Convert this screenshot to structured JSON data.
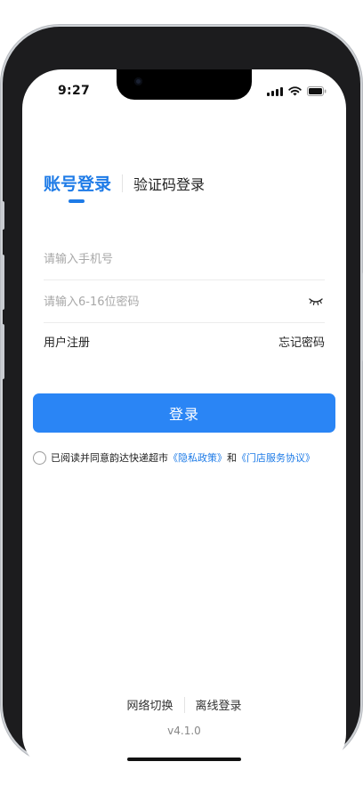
{
  "status_bar": {
    "time": "9:27"
  },
  "tabs": {
    "account_login": "账号登录",
    "code_login": "验证码登录"
  },
  "form": {
    "phone_placeholder": "请输入手机号",
    "phone_value": "",
    "password_placeholder": "请输入6-16位密码",
    "password_value": ""
  },
  "links": {
    "register": "用户注册",
    "forgot_password": "忘记密码"
  },
  "login_button": "登录",
  "agreement": {
    "checked": false,
    "text": "已阅读并同意韵达快递超市",
    "privacy_policy": "《隐私政策》",
    "and": "和",
    "store_agreement": "《门店服务协议》"
  },
  "footer": {
    "network_switch": "网络切换",
    "offline_login": "离线登录",
    "version": "v4.1.0"
  },
  "colors": {
    "accent": "#1e7be7",
    "button": "#2a85f5"
  },
  "icons": {
    "signal": "signal-icon",
    "wifi": "wifi-icon",
    "battery": "battery-icon",
    "password_toggle": "eye-closed-icon"
  }
}
